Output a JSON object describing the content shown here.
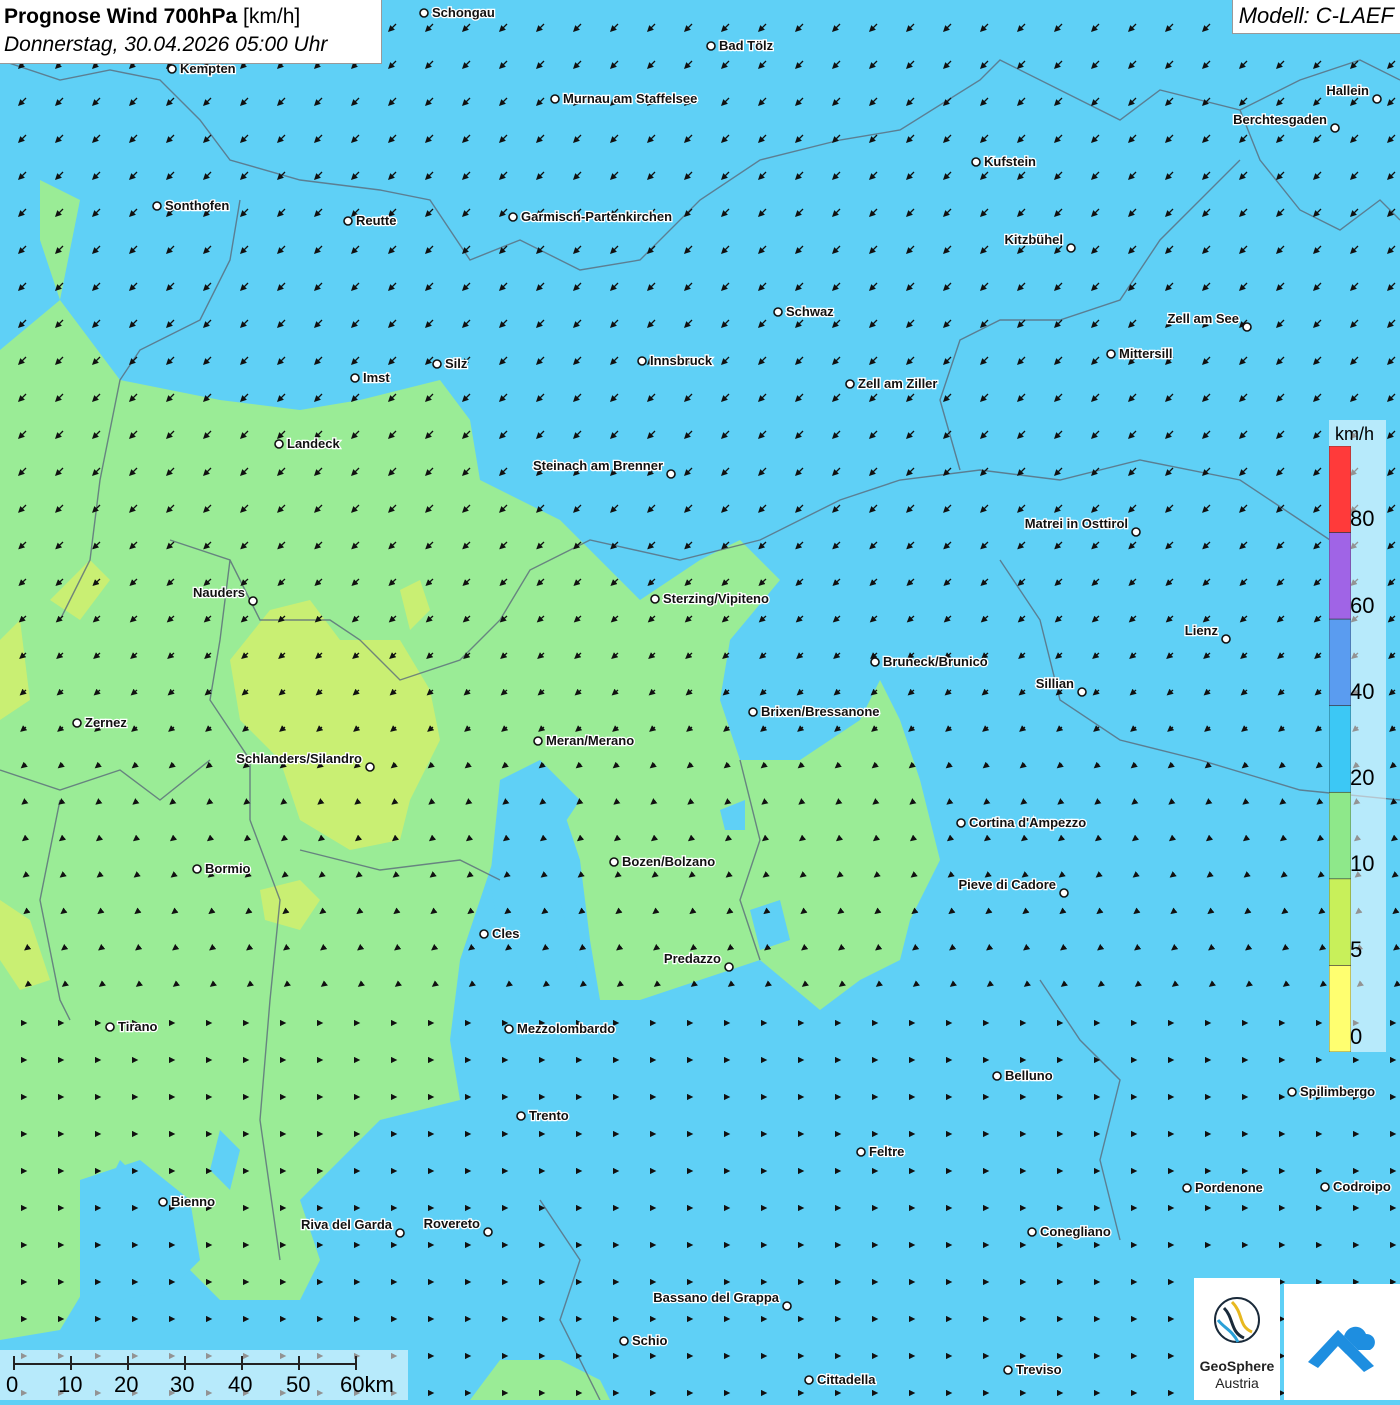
{
  "title": {
    "main": "Prognose Wind 700hPa",
    "unit": "[km/h]",
    "datetime": "Donnerstag, 30.04.2026 05:00 Uhr"
  },
  "model": "Modell: C-LAEF",
  "legend": {
    "unit": "km/h",
    "labels": [
      "80",
      "60",
      "40",
      "20",
      "10",
      "5",
      "0"
    ],
    "colors": [
      "#ff3a3a",
      "#a064e6",
      "#5a9cf0",
      "#3cc8f5",
      "#8ee88a",
      "#c8f05a",
      "#ffff70"
    ]
  },
  "scalebar": {
    "labels": [
      "0",
      "10",
      "20",
      "30",
      "40",
      "50",
      "60km"
    ]
  },
  "logo": {
    "name": "GeoSphere",
    "sub": "Austria"
  },
  "colors": {
    "sea": "#5fd0f6",
    "calm": "#9aec96",
    "light": "#c9ef73",
    "arrow": "#111111"
  },
  "cities": [
    {
      "name": "Schongau"
    },
    {
      "name": "Kempten"
    },
    {
      "name": "Bad Tölz"
    },
    {
      "name": "Murnau am Staffelsee"
    },
    {
      "name": "Hallein"
    },
    {
      "name": "Berchtesgaden"
    },
    {
      "name": "Kufstein"
    },
    {
      "name": "Sonthofen"
    },
    {
      "name": "Reutte"
    },
    {
      "name": "Garmisch-Partenkirchen"
    },
    {
      "name": "Kitzbühel"
    },
    {
      "name": "Schwaz"
    },
    {
      "name": "Zell am See"
    },
    {
      "name": "Mittersill"
    },
    {
      "name": "Imst"
    },
    {
      "name": "Silz"
    },
    {
      "name": "Innsbruck"
    },
    {
      "name": "Zell am Ziller"
    },
    {
      "name": "Landeck"
    },
    {
      "name": "Steinach am Brenner"
    },
    {
      "name": "Matrei in Osttirol"
    },
    {
      "name": "Nauders"
    },
    {
      "name": "Sterzing/Vipiteno"
    },
    {
      "name": "Lienz"
    },
    {
      "name": "Bruneck/Brunico"
    },
    {
      "name": "Sillian"
    },
    {
      "name": "Brixen/Bressanone"
    },
    {
      "name": "Zernez"
    },
    {
      "name": "Meran/Merano"
    },
    {
      "name": "Schlanders/Silandro"
    },
    {
      "name": "Cortina d'Ampezzo"
    },
    {
      "name": "Bozen/Bolzano"
    },
    {
      "name": "Bormio"
    },
    {
      "name": "Pieve di Cadore"
    },
    {
      "name": "Cles"
    },
    {
      "name": "Predazzo"
    },
    {
      "name": "Tirano"
    },
    {
      "name": "Mezzolombardo"
    },
    {
      "name": "Belluno"
    },
    {
      "name": "Spilimbergo"
    },
    {
      "name": "Trento"
    },
    {
      "name": "Feltre"
    },
    {
      "name": "Bienno"
    },
    {
      "name": "Pordenone"
    },
    {
      "name": "Codroipo"
    },
    {
      "name": "Riva del Garda"
    },
    {
      "name": "Rovereto"
    },
    {
      "name": "Conegliano"
    },
    {
      "name": "Bassano del Grappa"
    },
    {
      "name": "Schio"
    },
    {
      "name": "Treviso"
    },
    {
      "name": "Cittadella"
    }
  ]
}
